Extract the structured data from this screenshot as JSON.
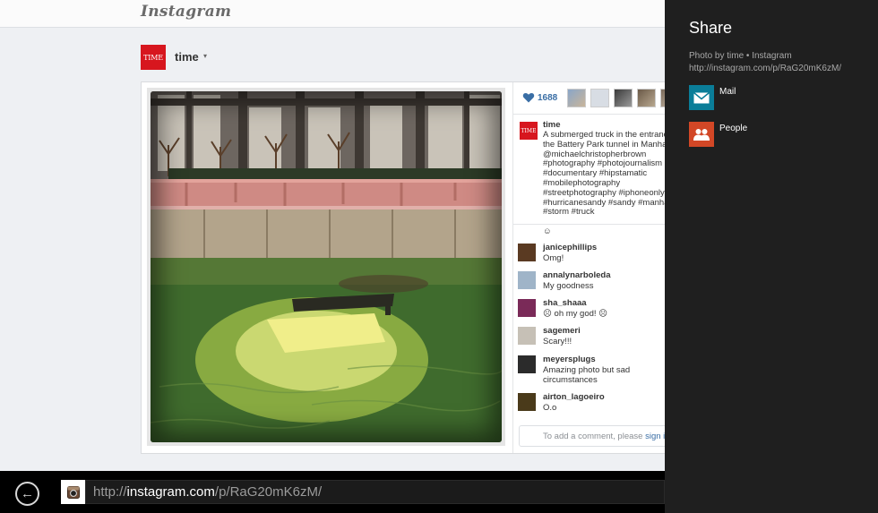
{
  "page": {
    "logo": "Instagram",
    "profile": {
      "avatar_text": "TIME",
      "name": "time",
      "caret": "▾"
    }
  },
  "post": {
    "likes": "1688",
    "caption": {
      "avatar_text": "TIME",
      "user": "time",
      "lines": [
        "A submerged truck in the entrance to",
        "the Battery Park tunnel in Manhattan",
        "@michaelchristopherbrown",
        "#photography #photojournalism",
        "#documentary #hipstamatic",
        "#mobilephotography",
        "#streetphotography #iphoneonly",
        "#hurricanesandy #sandy #manhattan",
        "#storm #truck"
      ]
    },
    "comment_fragment": "☺",
    "comments": [
      {
        "user": "janicephillips",
        "text": "Omg!",
        "avatar_color": "#5a3a22"
      },
      {
        "user": "annalynarboleda",
        "text": "My goodness",
        "avatar_color": "#9fb4c8"
      },
      {
        "user": "sha_shaaa",
        "text": "☹ oh my god! ☹",
        "avatar_color": "#7a2a58"
      },
      {
        "user": "sagemeri",
        "text": "Scary!!!",
        "avatar_color": "#c6c0b6"
      },
      {
        "user": "meyersplugs",
        "text": "Amazing photo but sad circumstances",
        "avatar_color": "#2b2b2b"
      },
      {
        "user": "airton_lagoeiro",
        "text": "O.o",
        "avatar_color": "#4a3a1a"
      }
    ],
    "add_comment": {
      "prefix": "To add a comment, please ",
      "link": "sign in"
    }
  },
  "browser": {
    "back_symbol": "←",
    "url_prefix": "http://",
    "url_host": "instagram.com",
    "url_path": "/p/RaG20mK6zM/"
  },
  "share": {
    "title": "Share",
    "description_line1": "Photo by time • Instagram",
    "description_line2": "http://instagram.com/p/RaG20mK6zM/",
    "targets": [
      {
        "label": "Mail",
        "icon": "mail-icon",
        "color": "#0a7d98"
      },
      {
        "label": "People",
        "icon": "people-icon",
        "color": "#d24726"
      }
    ]
  },
  "colors": {
    "page_bg": "#eef0f3",
    "share_bg": "#1f1f1f",
    "link_blue": "#3a6ea5",
    "time_red": "#d7161e"
  }
}
